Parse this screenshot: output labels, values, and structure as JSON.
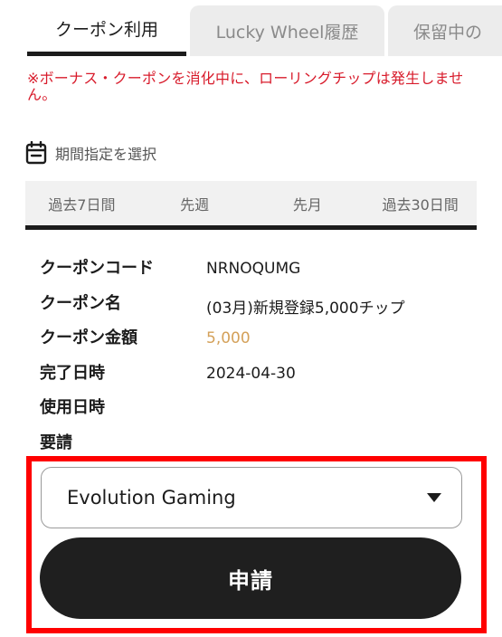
{
  "tabs": [
    {
      "label": "クーポン利用",
      "active": true
    },
    {
      "label": "Lucky Wheel履歴",
      "active": false
    },
    {
      "label": "保留中の",
      "active": false
    }
  ],
  "notice": "※ボーナス・クーポンを消化中に、ローリングチップは発生しません。",
  "period": {
    "icon": "calendar-icon",
    "label": "期間指定を選択",
    "ranges": [
      "過去7日間",
      "先週",
      "先月",
      "過去30日間"
    ]
  },
  "coupon": {
    "code_label": "クーポンコード",
    "code": "NRNOQUMG",
    "name_label": "クーポン名",
    "name": "(03月)新規登録5,000チップ",
    "amount_label": "クーポン金額",
    "amount": "5,000",
    "completed_label": "完了日時",
    "completed": "2024-04-30",
    "used_label": "使用日時",
    "used": "",
    "request_label": "要請"
  },
  "provider_select": {
    "value": "Evolution Gaming"
  },
  "apply_button": "申請",
  "colors": {
    "notice": "#d81b2b",
    "amount": "#d4a15a",
    "highlight": "#ff0000",
    "button": "#1f1f1f"
  }
}
